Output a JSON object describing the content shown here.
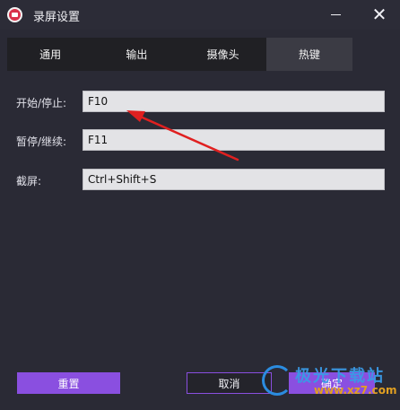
{
  "window": {
    "title": "录屏设置"
  },
  "tabs": [
    {
      "label": "通用",
      "active": false
    },
    {
      "label": "输出",
      "active": false
    },
    {
      "label": "摄像头",
      "active": false
    },
    {
      "label": "热键",
      "active": true
    }
  ],
  "hotkeys": [
    {
      "label": "开始/停止:",
      "value": "F10"
    },
    {
      "label": "暂停/继续:",
      "value": "F11"
    },
    {
      "label": "截屏:",
      "value": "Ctrl+Shift+S"
    }
  ],
  "buttons": {
    "reset": "重置",
    "cancel": "取消",
    "ok": "确定"
  },
  "watermark": {
    "line1": "极光下载站",
    "line2": "www.xz7.com"
  },
  "colors": {
    "accent": "#8a4fe0",
    "annotation_arrow": "#e02020"
  }
}
